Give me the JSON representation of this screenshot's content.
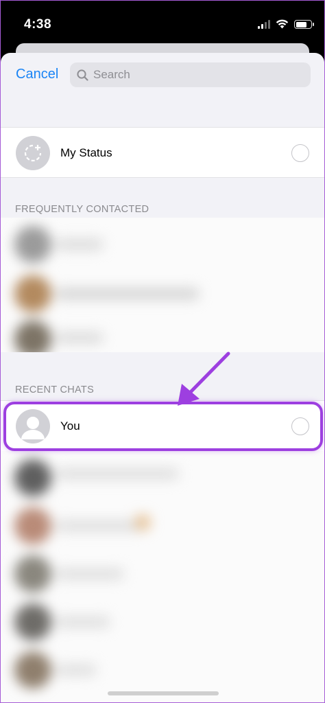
{
  "status_bar": {
    "time": "4:38"
  },
  "header": {
    "cancel_label": "Cancel",
    "search_placeholder": "Search"
  },
  "my_status": {
    "label": "My Status"
  },
  "sections": {
    "frequently_contacted": "FREQUENTLY CONTACTED",
    "recent_chats": "RECENT CHATS"
  },
  "recent": {
    "you_label": "You"
  },
  "colors": {
    "accent_blue": "#1a84f5",
    "highlight_purple": "#9d3fe0",
    "sheet_bg": "#f2f2f7"
  }
}
